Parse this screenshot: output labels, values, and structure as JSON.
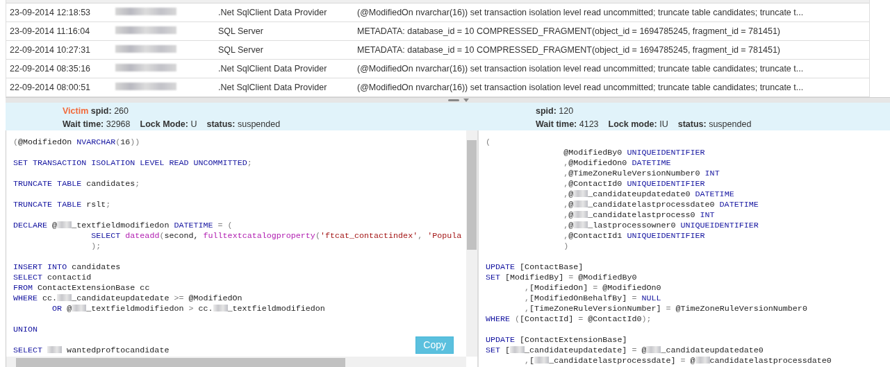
{
  "table": {
    "rows": [
      {
        "date": "23-09-2014 12:18:53",
        "redacted": true,
        "application": ".Net SqlClient Data Provider",
        "statement": "(@ModifiedOn nvarchar(16)) set transaction isolation level read uncommitted; truncate table candidates; truncate t..."
      },
      {
        "date": "23-09-2014 11:16:04",
        "redacted": true,
        "application": "SQL Server",
        "statement": "METADATA: database_id = 10 COMPRESSED_FRAGMENT(object_id = 1694785245, fragment_id = 781451)"
      },
      {
        "date": "22-09-2014 10:27:31",
        "redacted": true,
        "application": "SQL Server",
        "statement": "METADATA: database_id = 10 COMPRESSED_FRAGMENT(object_id = 1694785245, fragment_id = 781451)"
      },
      {
        "date": "22-09-2014 08:35:16",
        "redacted": true,
        "application": ".Net SqlClient Data Provider",
        "statement": "(@ModifiedOn nvarchar(16)) set transaction isolation level read uncommitted; truncate table candidates; truncate t..."
      },
      {
        "date": "22-09-2014 08:00:51",
        "redacted": true,
        "application": ".Net SqlClient Data Provider",
        "statement": "(@ModifiedOn nvarchar(16)) set transaction isolation level read uncommitted; truncate table candidates; truncate t..."
      }
    ]
  },
  "processes": [
    {
      "victim_label": "Victim",
      "spid_label": "spid:",
      "spid": "260",
      "wait_label": "Wait time:",
      "wait": "32968",
      "lock_label": "Lock Mode:",
      "lock": "U",
      "status_label": "status:",
      "status": "suspended",
      "copy_button": "Copy",
      "code": [
        {
          "kind": "plain",
          "parts": [
            {
              "kind": "op",
              "text": "("
            },
            {
              "kind": "txt",
              "text": "@ModifiedOn "
            },
            {
              "kind": "kw",
              "text": "NVARCHAR"
            },
            {
              "kind": "op",
              "text": "("
            },
            {
              "kind": "txt",
              "text": "16"
            },
            {
              "kind": "op",
              "text": "))"
            }
          ]
        },
        {
          "kind": "plain",
          "gap_before": true,
          "parts": [
            {
              "kind": "kw",
              "text": "SET TRANSACTION ISOLATION LEVEL READ UNCOMMITTED"
            },
            {
              "kind": "op",
              "text": ";"
            }
          ]
        },
        {
          "kind": "plain",
          "gap_before": true,
          "parts": [
            {
              "kind": "kw",
              "text": "TRUNCATE TABLE "
            },
            {
              "kind": "txt",
              "text": "candidates"
            },
            {
              "kind": "op",
              "text": ";"
            }
          ]
        },
        {
          "kind": "plain",
          "gap_before": true,
          "parts": [
            {
              "kind": "kw",
              "text": "TRUNCATE TABLE "
            },
            {
              "kind": "txt",
              "text": "rslt"
            },
            {
              "kind": "op",
              "text": ";"
            }
          ]
        },
        {
          "kind": "plain",
          "gap_before": true,
          "parts": [
            {
              "kind": "kw",
              "text": "DECLARE "
            },
            {
              "kind": "txt",
              "text": "@"
            },
            {
              "kind": "redact"
            },
            {
              "kind": "txt",
              "text": "_textfieldmodifiedon "
            },
            {
              "kind": "kw",
              "text": "DATETIME "
            },
            {
              "kind": "op",
              "text": "= ("
            }
          ]
        },
        {
          "kind": "nested",
          "parts": [
            {
              "kind": "kw",
              "text": "SELECT "
            },
            {
              "kind": "fn",
              "text": "dateadd"
            },
            {
              "kind": "op",
              "text": "("
            },
            {
              "kind": "txt",
              "text": "second, "
            },
            {
              "kind": "fn",
              "text": "fulltextcatalogproperty"
            },
            {
              "kind": "op",
              "text": "("
            },
            {
              "kind": "str",
              "text": "'ftcat_contactindex'"
            },
            {
              "kind": "op",
              "text": ", "
            },
            {
              "kind": "str",
              "text": "'Popula"
            }
          ]
        },
        {
          "kind": "nested",
          "parts": [
            {
              "kind": "op",
              "text": ");"
            }
          ]
        },
        {
          "kind": "plain",
          "gap_before": true,
          "parts": [
            {
              "kind": "kw",
              "text": "INSERT INTO "
            },
            {
              "kind": "txt",
              "text": "candidates"
            }
          ]
        },
        {
          "kind": "plain",
          "parts": [
            {
              "kind": "kw",
              "text": "SELECT "
            },
            {
              "kind": "txt",
              "text": "contactid"
            }
          ]
        },
        {
          "kind": "plain",
          "parts": [
            {
              "kind": "kw",
              "text": "FROM "
            },
            {
              "kind": "txt",
              "text": "ContactExtensionBase cc"
            }
          ]
        },
        {
          "kind": "plain",
          "parts": [
            {
              "kind": "kw",
              "text": "WHERE "
            },
            {
              "kind": "txt",
              "text": "cc."
            },
            {
              "kind": "redact"
            },
            {
              "kind": "txt",
              "text": "_candidateupdatedate "
            },
            {
              "kind": "op",
              "text": ">= "
            },
            {
              "kind": "txt",
              "text": "@ModifiedOn"
            }
          ]
        },
        {
          "kind": "indented",
          "parts": [
            {
              "kind": "kw",
              "text": "OR "
            },
            {
              "kind": "txt",
              "text": "@"
            },
            {
              "kind": "redact"
            },
            {
              "kind": "txt",
              "text": "_textfieldmodifiedon "
            },
            {
              "kind": "op",
              "text": "> "
            },
            {
              "kind": "txt",
              "text": "cc."
            },
            {
              "kind": "redact"
            },
            {
              "kind": "txt",
              "text": "_textfieldmodifiedon"
            }
          ]
        },
        {
          "kind": "plain",
          "gap_before": true,
          "parts": [
            {
              "kind": "kw",
              "text": "UNION"
            }
          ]
        },
        {
          "kind": "plain",
          "gap_before": true,
          "parts": [
            {
              "kind": "kw",
              "text": "SELECT "
            },
            {
              "kind": "redact"
            },
            {
              "kind": "txt",
              "text": " wantedproftocandidate"
            }
          ]
        }
      ]
    },
    {
      "spid_label": "spid:",
      "spid": "120",
      "wait_label": "Wait time:",
      "wait": "4123",
      "lock_label": "Lock mode:",
      "lock": "IU",
      "status_label": "status:",
      "status": "suspended",
      "code": [
        {
          "kind": "plain",
          "parts": [
            {
              "kind": "op",
              "text": "("
            }
          ]
        },
        {
          "kind": "nested",
          "parts": [
            {
              "kind": "txt",
              "text": "@ModifiedBy0 "
            },
            {
              "kind": "kw",
              "text": "UNIQUEIDENTIFIER"
            }
          ]
        },
        {
          "kind": "nested",
          "parts": [
            {
              "kind": "op",
              "text": ","
            },
            {
              "kind": "txt",
              "text": "@ModifiedOn0 "
            },
            {
              "kind": "kw",
              "text": "DATETIME"
            }
          ]
        },
        {
          "kind": "nested",
          "parts": [
            {
              "kind": "op",
              "text": ","
            },
            {
              "kind": "txt",
              "text": "@TimeZoneRuleVersionNumber0 "
            },
            {
              "kind": "kw",
              "text": "INT"
            }
          ]
        },
        {
          "kind": "nested",
          "parts": [
            {
              "kind": "op",
              "text": ","
            },
            {
              "kind": "txt",
              "text": "@ContactId0 "
            },
            {
              "kind": "kw",
              "text": "UNIQUEIDENTIFIER"
            }
          ]
        },
        {
          "kind": "nested",
          "parts": [
            {
              "kind": "op",
              "text": ","
            },
            {
              "kind": "txt",
              "text": "@"
            },
            {
              "kind": "redact"
            },
            {
              "kind": "txt",
              "text": "_candidateupdatedate0 "
            },
            {
              "kind": "kw",
              "text": "DATETIME"
            }
          ]
        },
        {
          "kind": "nested",
          "parts": [
            {
              "kind": "op",
              "text": ","
            },
            {
              "kind": "txt",
              "text": "@"
            },
            {
              "kind": "redact"
            },
            {
              "kind": "txt",
              "text": "_candidatelastprocessdate0 "
            },
            {
              "kind": "kw",
              "text": "DATETIME"
            }
          ]
        },
        {
          "kind": "nested",
          "parts": [
            {
              "kind": "op",
              "text": ","
            },
            {
              "kind": "txt",
              "text": "@"
            },
            {
              "kind": "redact"
            },
            {
              "kind": "txt",
              "text": "_candidatelastprocess0 "
            },
            {
              "kind": "kw",
              "text": "INT"
            }
          ]
        },
        {
          "kind": "nested",
          "parts": [
            {
              "kind": "op",
              "text": ","
            },
            {
              "kind": "txt",
              "text": "@"
            },
            {
              "kind": "redact"
            },
            {
              "kind": "txt",
              "text": "_lastprocessowner0 "
            },
            {
              "kind": "kw",
              "text": "UNIQUEIDENTIFIER"
            }
          ]
        },
        {
          "kind": "nested",
          "parts": [
            {
              "kind": "op",
              "text": ","
            },
            {
              "kind": "txt",
              "text": "@ContactId1 "
            },
            {
              "kind": "kw",
              "text": "UNIQUEIDENTIFIER"
            }
          ]
        },
        {
          "kind": "nested",
          "parts": [
            {
              "kind": "op",
              "text": ")"
            }
          ]
        },
        {
          "kind": "plain",
          "gap_before": true,
          "parts": [
            {
              "kind": "kw",
              "text": "UPDATE "
            },
            {
              "kind": "txt",
              "text": "[ContactBase]"
            }
          ]
        },
        {
          "kind": "plain",
          "parts": [
            {
              "kind": "kw",
              "text": "SET "
            },
            {
              "kind": "txt",
              "text": "[ModifiedBy] "
            },
            {
              "kind": "op",
              "text": "= "
            },
            {
              "kind": "txt",
              "text": "@ModifiedBy0"
            }
          ]
        },
        {
          "kind": "indented",
          "parts": [
            {
              "kind": "op",
              "text": ","
            },
            {
              "kind": "txt",
              "text": "[ModifiedOn] "
            },
            {
              "kind": "op",
              "text": "= "
            },
            {
              "kind": "txt",
              "text": "@ModifiedOn0"
            }
          ]
        },
        {
          "kind": "indented",
          "parts": [
            {
              "kind": "op",
              "text": ","
            },
            {
              "kind": "txt",
              "text": "[ModifiedOnBehalfBy] "
            },
            {
              "kind": "op",
              "text": "= "
            },
            {
              "kind": "kw",
              "text": "NULL"
            }
          ]
        },
        {
          "kind": "indented",
          "parts": [
            {
              "kind": "op",
              "text": ","
            },
            {
              "kind": "txt",
              "text": "[TimeZoneRuleVersionNumber] "
            },
            {
              "kind": "op",
              "text": "= "
            },
            {
              "kind": "txt",
              "text": "@TimeZoneRuleVersionNumber0"
            }
          ]
        },
        {
          "kind": "plain",
          "parts": [
            {
              "kind": "kw",
              "text": "WHERE "
            },
            {
              "kind": "op",
              "text": "("
            },
            {
              "kind": "txt",
              "text": "[ContactId] "
            },
            {
              "kind": "op",
              "text": "= "
            },
            {
              "kind": "txt",
              "text": "@ContactId0"
            },
            {
              "kind": "op",
              "text": ");"
            }
          ]
        },
        {
          "kind": "plain",
          "gap_before": true,
          "parts": [
            {
              "kind": "kw",
              "text": "UPDATE "
            },
            {
              "kind": "txt",
              "text": "[ContactExtensionBase]"
            }
          ]
        },
        {
          "kind": "plain",
          "parts": [
            {
              "kind": "kw",
              "text": "SET "
            },
            {
              "kind": "txt",
              "text": "["
            },
            {
              "kind": "redact"
            },
            {
              "kind": "txt",
              "text": "_candidateupdatedate] "
            },
            {
              "kind": "op",
              "text": "= "
            },
            {
              "kind": "txt",
              "text": "@"
            },
            {
              "kind": "redact"
            },
            {
              "kind": "txt",
              "text": "_candidateupdatedate0"
            }
          ]
        },
        {
          "kind": "indented",
          "parts": [
            {
              "kind": "op",
              "text": ","
            },
            {
              "kind": "txt",
              "text": "["
            },
            {
              "kind": "redact"
            },
            {
              "kind": "txt",
              "text": "_candidatelastprocessdate] "
            },
            {
              "kind": "op",
              "text": "= "
            },
            {
              "kind": "txt",
              "text": "@"
            },
            {
              "kind": "redact"
            },
            {
              "kind": "txt",
              "text": "candidatelastprocessdate0"
            }
          ]
        }
      ]
    }
  ]
}
